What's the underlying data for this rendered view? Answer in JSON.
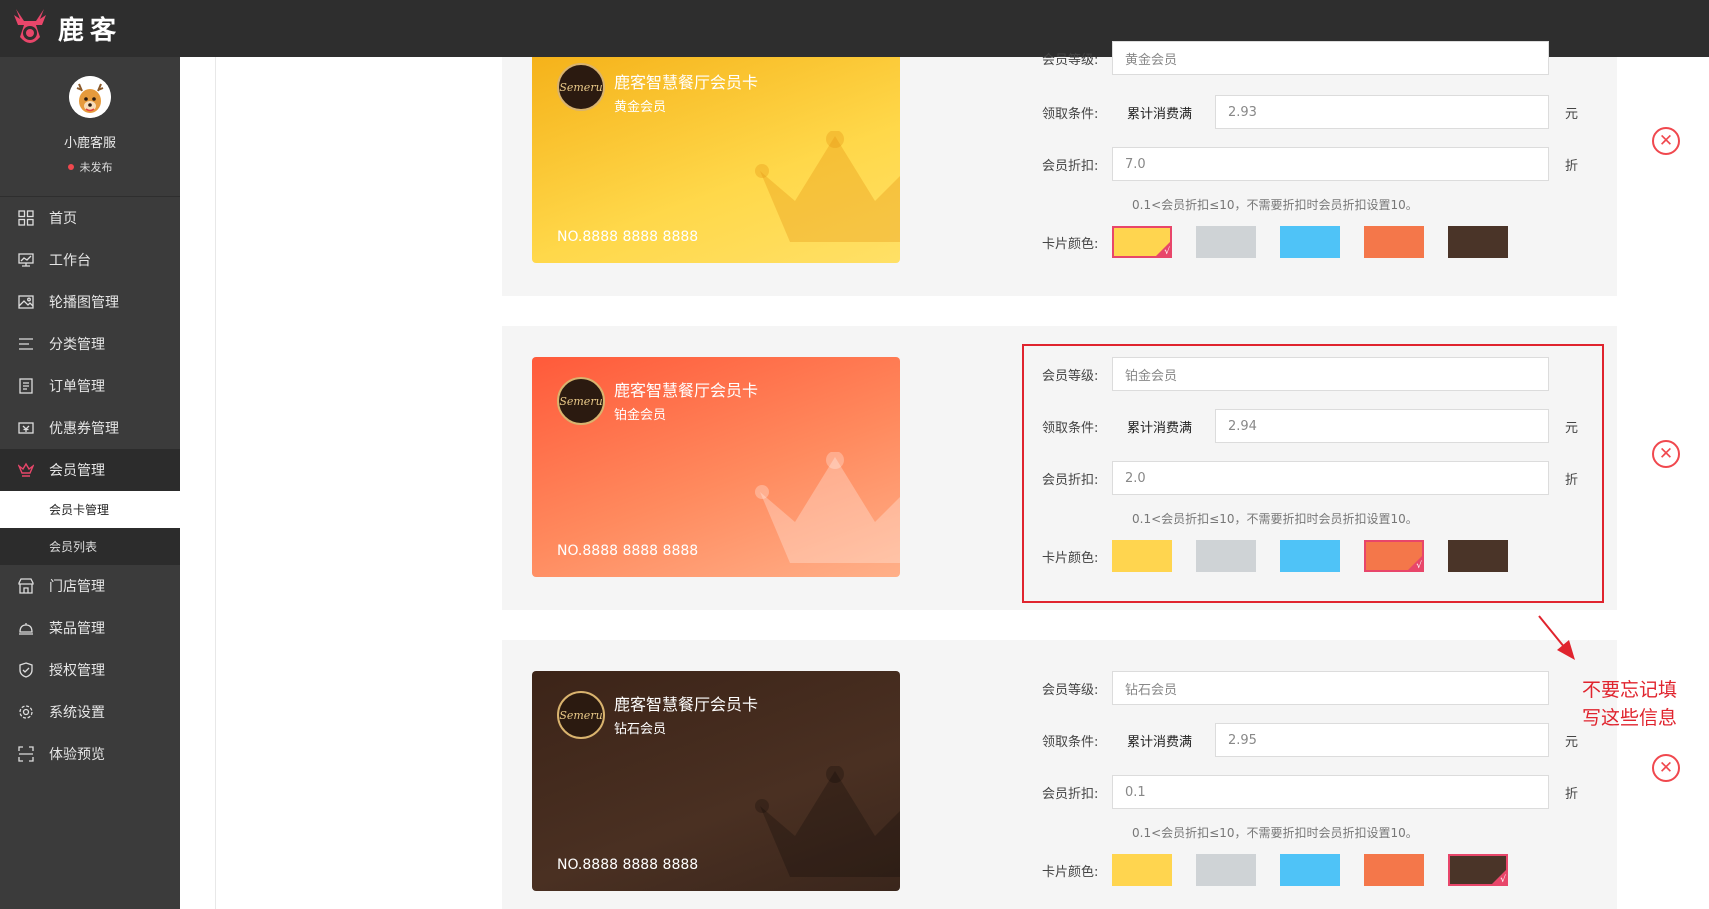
{
  "app": {
    "name": "鹿客"
  },
  "profile": {
    "name": "小鹿客服",
    "status": "未发布"
  },
  "nav": {
    "items": [
      {
        "label": "首页",
        "icon": "grid-icon"
      },
      {
        "label": "工作台",
        "icon": "monitor-icon"
      },
      {
        "label": "轮播图管理",
        "icon": "image-icon"
      },
      {
        "label": "分类管理",
        "icon": "list-icon"
      },
      {
        "label": "订单管理",
        "icon": "document-icon"
      },
      {
        "label": "优惠券管理",
        "icon": "coupon-icon"
      },
      {
        "label": "会员管理",
        "icon": "crown-icon"
      },
      {
        "label": "门店管理",
        "icon": "store-icon"
      },
      {
        "label": "菜品管理",
        "icon": "dish-icon"
      },
      {
        "label": "授权管理",
        "icon": "shield-icon"
      },
      {
        "label": "系统设置",
        "icon": "gear-icon"
      },
      {
        "label": "体验预览",
        "icon": "scan-icon"
      }
    ],
    "member_sub": [
      {
        "label": "会员卡管理"
      },
      {
        "label": "会员列表"
      }
    ]
  },
  "labels": {
    "level": "会员等级:",
    "condition": "领取条件:",
    "condition_text": "累计消费满",
    "unit_yuan": "元",
    "discount": "会员折扣:",
    "unit_zhe": "折",
    "hint": "0.1<会员折扣≤10，不需要折扣时会员折扣设置10。",
    "color": "卡片颜色:"
  },
  "card_common": {
    "title": "鹿客智慧餐厅会员卡",
    "number": "NO.8888 8888 8888",
    "badge": "Semeru"
  },
  "swatch_colors": [
    "#ffd54f",
    "#cfd3d6",
    "#4fc3f7",
    "#f4774a",
    "#4a3428"
  ],
  "cards": [
    {
      "level": "黄金会员",
      "condition": "2.93",
      "discount": "7.0",
      "selected_color": 0
    },
    {
      "level": "铂金会员",
      "condition": "2.94",
      "discount": "2.0",
      "selected_color": 3
    },
    {
      "level": "钻石会员",
      "condition": "2.95",
      "discount": "0.1",
      "selected_color": 4
    }
  ],
  "annotation": {
    "line1": "不要忘记填",
    "line2": "写这些信息"
  }
}
